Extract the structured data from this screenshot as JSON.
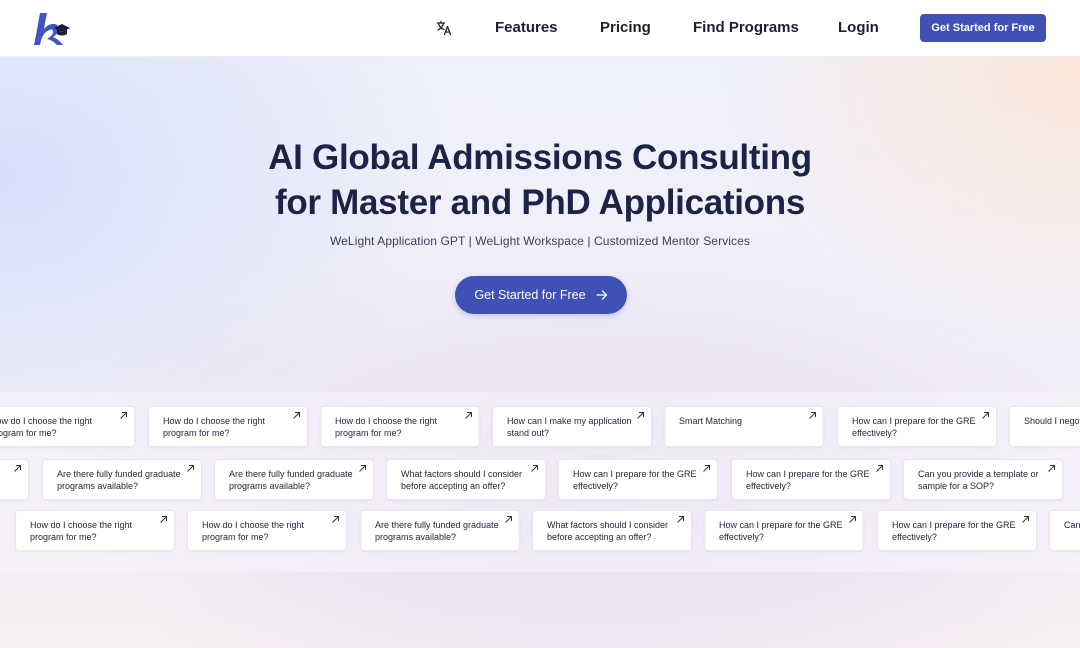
{
  "nav": {
    "logo_icon": "welight-logo-icon",
    "language_icon": "translate-icon",
    "links": {
      "features": "Features",
      "pricing": "Pricing",
      "find_programs": "Find Programs",
      "login": "Login"
    },
    "cta": "Get Started for Free",
    "colors": {
      "accent": "#3f51b5",
      "logo_accent": "#1b1b3a"
    }
  },
  "hero": {
    "title_line1": "AI Global Admissions Consulting",
    "title_line2": "for Master and PhD Applications",
    "subtitle": "WeLight Application GPT | WeLight Workspace | Customized Mentor Services",
    "cta": "Get Started for Free",
    "cta_icon": "arrow-right-icon"
  },
  "questions": {
    "card_icon": "arrow-up-right-icon",
    "row1": [
      "How do I choose the right program for me?",
      "How do I choose the right program for me?",
      "How do I choose the right program for me?",
      "How can I make my application stand out?",
      "Smart Matching",
      "How can I prepare for the GRE effectively?",
      "Should I negotiate offers or stipends?"
    ],
    "row2": [
      "",
      "Are there fully funded graduate programs available?",
      "Are there fully funded graduate programs available?",
      "What factors should I consider before accepting an offer?",
      "How can I prepare for the GRE effectively?",
      "How can I prepare for the GRE effectively?",
      "Can you provide a template or sample for a SOP?"
    ],
    "row3": [
      "How do I choose the right program for me?",
      "How do I choose the right program for me?",
      "Are there fully funded graduate programs available?",
      "What factors should I consider before accepting an offer?",
      "How can I prepare for the GRE effectively?",
      "How can I prepare for the GRE effectively?",
      "Can you provide a template or sample for a SOP?"
    ]
  }
}
